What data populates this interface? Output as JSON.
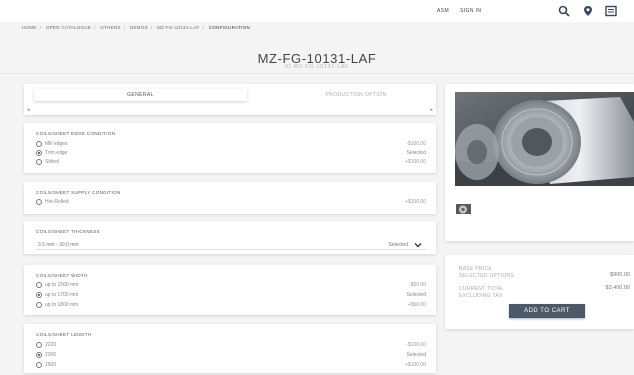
{
  "header": {
    "asm_label": "ASM",
    "signin_label": "SIGN IN",
    "icons": [
      "search-icon",
      "location-pin-icon",
      "cart-icon"
    ]
  },
  "breadcrumb": [
    "HOME",
    "OPEN CATALOGUE",
    "OTHERS",
    "DEMOS",
    "MZ-FG-10131-LAF",
    "CONFIGURATION"
  ],
  "product": {
    "title": "MZ-FG-10131-LAF",
    "subtitle": "ID MZ-FG-10131-LAF"
  },
  "tabs": [
    {
      "label": "GENERAL",
      "active": true
    },
    {
      "label": "PRODUCTION OPTION",
      "active": false
    }
  ],
  "sections": {
    "edge": {
      "title": "COILS/SHEET EDGE CONDITION",
      "options": [
        {
          "label": "Mill edges",
          "price": "-$100.00",
          "selected": false
        },
        {
          "label": "Trim edge",
          "price": "Selected",
          "selected": true
        },
        {
          "label": "Slitted",
          "price": "+$100.00",
          "selected": false
        }
      ]
    },
    "supply": {
      "title": "COILS/SHEET SUPPLY CONDITION",
      "options": [
        {
          "label": "Hot-Rolled",
          "price": "+$150.00",
          "selected": false
        }
      ]
    },
    "thickness": {
      "title": "COILS/SHEET THICKNESS",
      "value": "3.5 mm - 30.0 mm",
      "status": "Selected"
    },
    "width": {
      "title": "COILS/SHEET WIDTH",
      "options": [
        {
          "label": "up to 1500 mm",
          "price": "-$50.00",
          "selected": false
        },
        {
          "label": "up to 1700 mm",
          "price": "Selected",
          "selected": true
        },
        {
          "label": "up to 1800 mm",
          "price": "+$50.00",
          "selected": false
        }
      ]
    },
    "length": {
      "title": "COILS/SHEET LENGTH",
      "options": [
        {
          "label": "2220",
          "price": "-$100.00",
          "selected": false
        },
        {
          "label": "2300",
          "price": "Selected",
          "selected": true
        },
        {
          "label": "2500",
          "price": "+$100.00",
          "selected": false
        }
      ]
    }
  },
  "pricing": {
    "base_label": "BASE PRICE",
    "options_label": "SELECTED OPTIONS",
    "options_value": "$900.00",
    "total_label": "CURRENT TOTAL",
    "total_sub_label": "EXCLUDING TAX",
    "total_value": "$3,400.00",
    "cart_button": "ADD TO CART"
  },
  "colors": {
    "accent": "#4a5868",
    "background": "#f4f4f4"
  }
}
